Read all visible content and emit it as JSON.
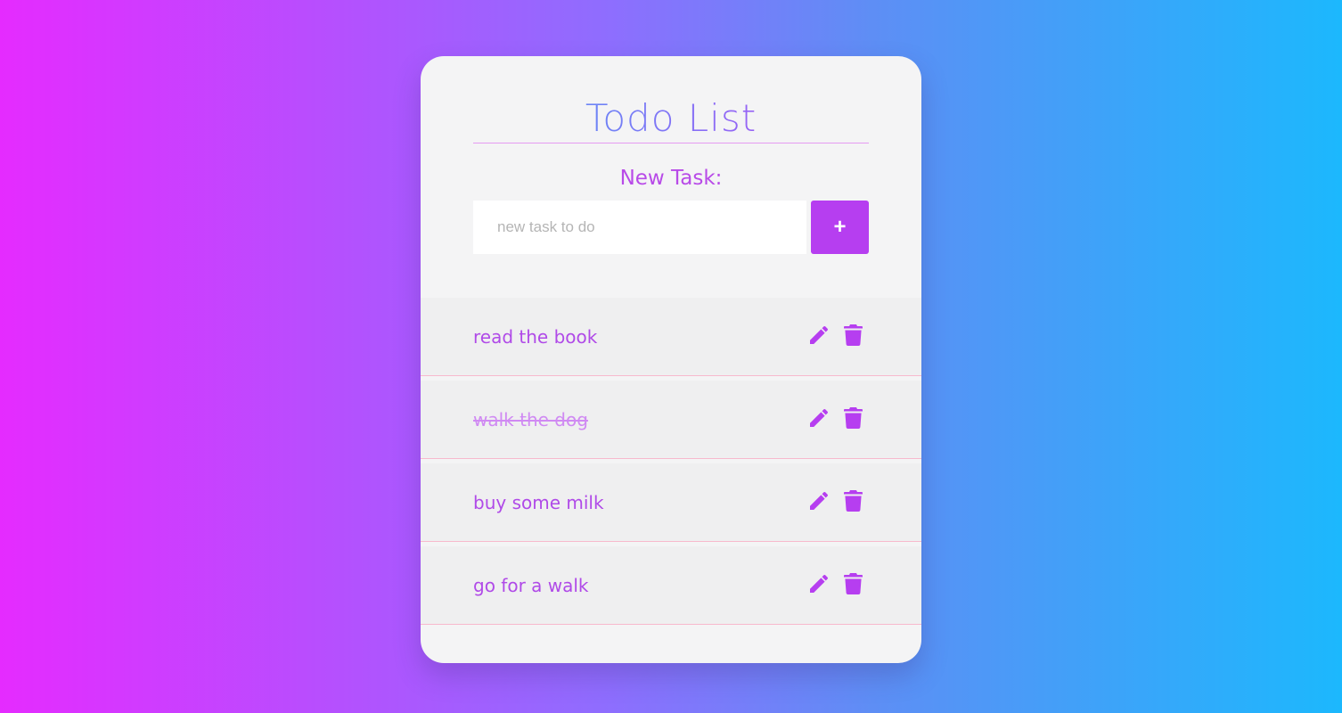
{
  "app": {
    "title": "Todo List"
  },
  "form": {
    "label": "New Task:",
    "input_value": "",
    "input_placeholder": "new task to do",
    "add_label": "+"
  },
  "icons": {
    "edit": "pencil-icon",
    "delete": "trash-icon"
  },
  "colors": {
    "accent": "#b63ef0",
    "title_gradient_start": "#4f9cf6",
    "title_gradient_end": "#b44cf5",
    "background_start": "#e52bff",
    "background_end": "#1cb8fd"
  },
  "tasks": [
    {
      "text": "read the book",
      "completed": false
    },
    {
      "text": "walk the dog",
      "completed": true
    },
    {
      "text": "buy some milk",
      "completed": false
    },
    {
      "text": "go for a walk",
      "completed": false
    }
  ]
}
